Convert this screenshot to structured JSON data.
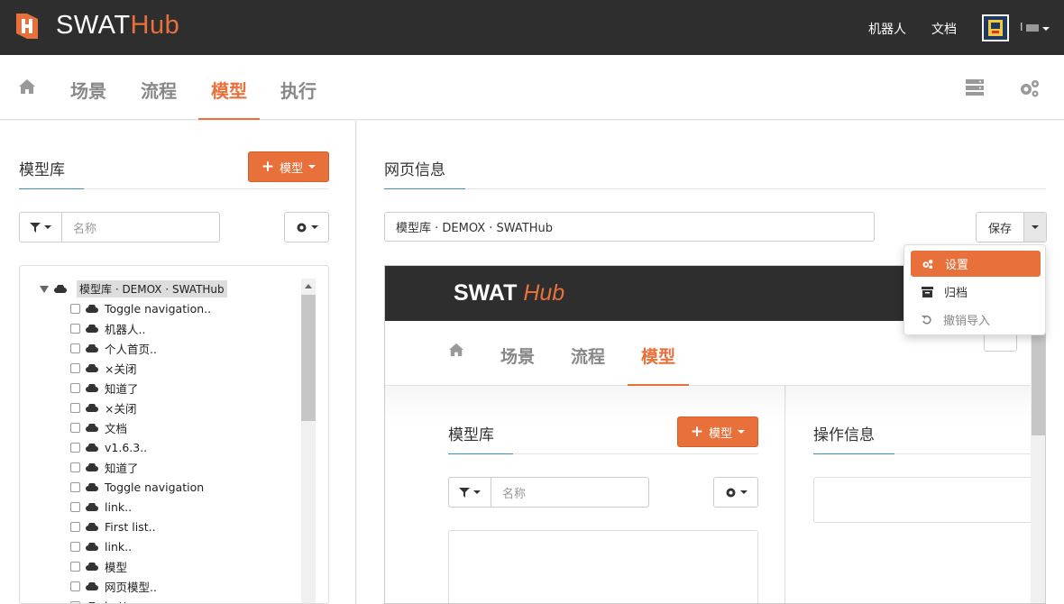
{
  "topbar": {
    "logo_main": "SWAT",
    "logo_accent": "Hub",
    "links": [
      "机器人",
      "文档"
    ],
    "user": "I"
  },
  "subnav": {
    "tabs": [
      "场景",
      "流程",
      "模型",
      "执行"
    ],
    "active_tab": "模型"
  },
  "left": {
    "title": "模型库",
    "add_button": "模型",
    "filter_placeholder": "名称",
    "tree_root": "模型库 · DEMOX · SWATHub",
    "tree_items": [
      "Toggle navigation..",
      "机器人..",
      "个人首页..",
      "×关闭",
      "知道了",
      "×关闭",
      "文档",
      "v1.6.3..",
      "知道了",
      "Toggle navigation",
      "link..",
      "First list..",
      "link..",
      "模型",
      "网页模型..",
      "butt..."
    ]
  },
  "right": {
    "title": "网页信息",
    "page_name": "模型库 · DEMOX · SWATHub",
    "save_label": "保存",
    "menu": [
      {
        "label": "设置",
        "icon": "gears-icon",
        "state": "active"
      },
      {
        "label": "归档",
        "icon": "archive-icon",
        "state": "normal"
      },
      {
        "label": "撤销导入",
        "icon": "undo-icon",
        "state": "disabled"
      }
    ]
  },
  "preview": {
    "logo_main": "SWAT",
    "logo_accent": "Hub",
    "tabs": [
      "场景",
      "流程",
      "模型"
    ],
    "active_tab": "模型",
    "left_title": "模型库",
    "add_button": "模型",
    "filter_placeholder": "名称",
    "right_title": "操作信息"
  },
  "colors": {
    "accent": "#e8703a",
    "topbar": "#2e2e2e",
    "section_accent": "#3c8dbc"
  }
}
